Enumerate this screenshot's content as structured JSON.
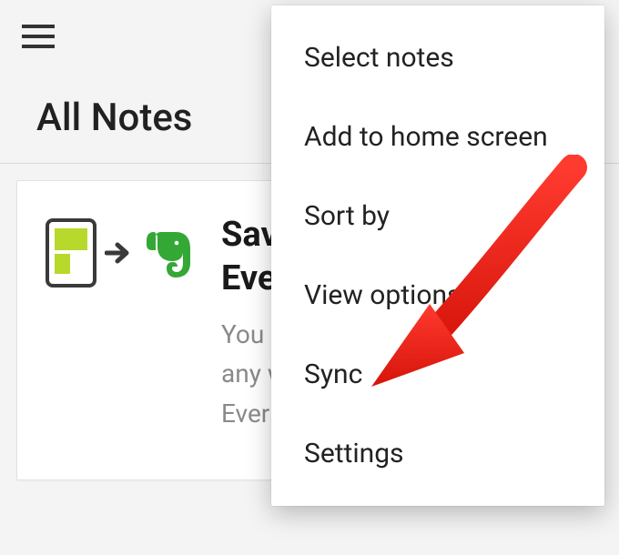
{
  "header": {
    "menu_button": "Menu"
  },
  "page_title": "All Notes",
  "card": {
    "heading_line1": "Save",
    "heading_line2": "Evern",
    "body_line1": "You ca",
    "body_line2": "any we",
    "body_line3": "Evernot"
  },
  "menu": {
    "items": [
      "Select notes",
      "Add to home screen",
      "Sort by",
      "View options",
      "Sync",
      "Settings"
    ]
  },
  "highlight_target_index": 4
}
